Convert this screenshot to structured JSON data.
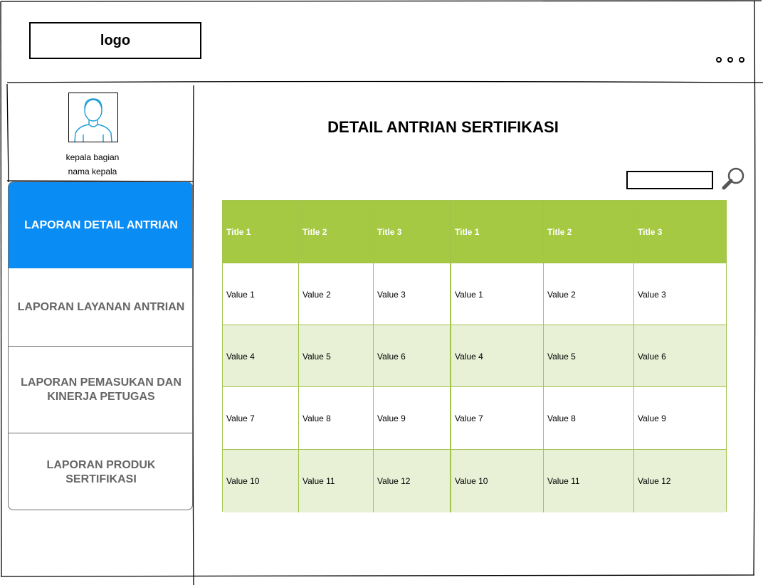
{
  "header": {
    "logo_text": "logo",
    "more_icon": "ellipsis-icon"
  },
  "user": {
    "avatar_icon": "user-avatar-icon",
    "role": "kepala bagian",
    "name": "nama kepala"
  },
  "sidebar": {
    "items": [
      {
        "label": "LAPORAN DETAIL ANTRIAN",
        "active": true
      },
      {
        "label": "LAPORAN LAYANAN ANTRIAN",
        "active": false
      },
      {
        "label": "LAPORAN PEMASUKAN DAN KINERJA PETUGAS",
        "active": false
      },
      {
        "label": "LAPORAN PRODUK SERTIFIKASI",
        "active": false
      }
    ]
  },
  "main": {
    "title": "DETAIL ANTRIAN SERTIFIKASI",
    "search": {
      "placeholder": "",
      "icon": "search-icon"
    },
    "table": {
      "headers": [
        "Title 1",
        "Title 2",
        "Title 3",
        "Title 1",
        "Title 2",
        "Title 3"
      ],
      "rows": [
        [
          "Value 1",
          "Value 2",
          "Value 3",
          "Value 1",
          "Value 2",
          "Value 3"
        ],
        [
          "Value 4",
          "Value 5",
          "Value 6",
          "Value 4",
          "Value 5",
          "Value 6"
        ],
        [
          "Value 7",
          "Value 8",
          "Value 9",
          "Value 7",
          "Value 8",
          "Value 9"
        ],
        [
          "Value 10",
          "Value 11",
          "Value 12",
          "Value 10",
          "Value 11",
          "Value 12"
        ]
      ]
    }
  },
  "colors": {
    "accent": "#0a8cf5",
    "table_header": "#a6c944",
    "table_alt_row": "#e8f0d6",
    "menu_text": "#666666"
  }
}
